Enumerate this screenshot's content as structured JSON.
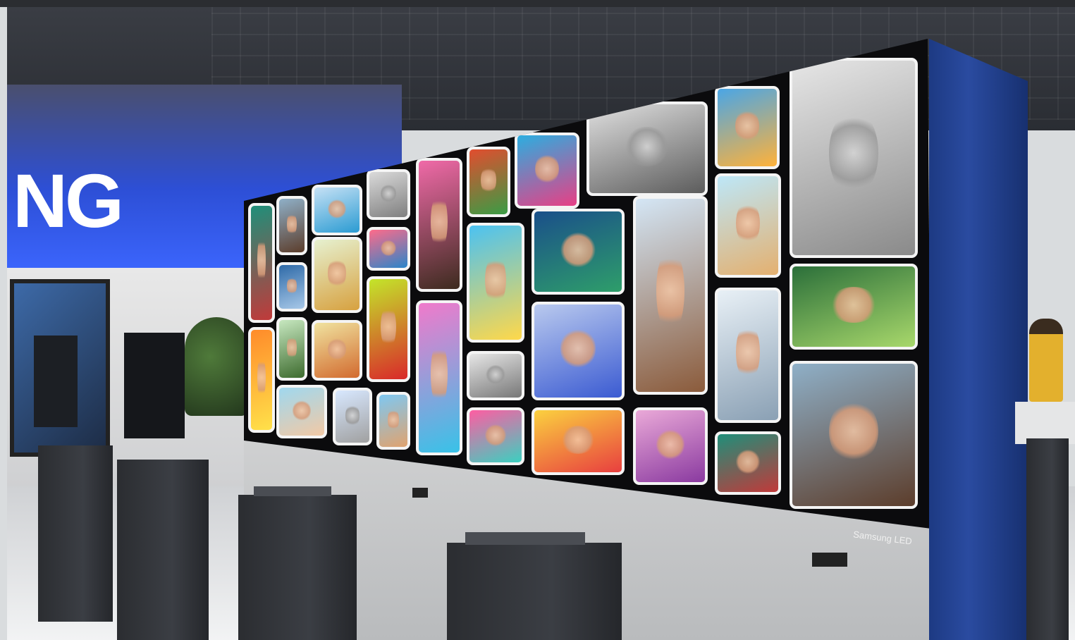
{
  "scene": {
    "brand_sign_text": "NG",
    "display_label": "Samsung LED"
  },
  "photos": [
    {
      "c1": "#1f8f7a",
      "c2": "#c13a3a"
    },
    {
      "c1": "#8fb0c8",
      "c2": "#5c3d2b"
    },
    {
      "c1": "#c6e1f5",
      "c2": "#2a9bd2"
    },
    {
      "c1": "#dadada",
      "c2": "#7f7f7f",
      "bw": true
    },
    {
      "c1": "#f06aa8",
      "c2": "#3d2b1f"
    },
    {
      "c1": "#e24d2f",
      "c2": "#3a9c45"
    },
    {
      "c1": "#2baee0",
      "c2": "#e83f85"
    },
    {
      "c1": "#e0e0e0",
      "c2": "#5c5c5c",
      "bw": true
    },
    {
      "c1": "#4aa6e6",
      "c2": "#ffb23a"
    },
    {
      "c1": "#e6e6e6",
      "c2": "#8a8a8a",
      "bw": true
    },
    {
      "c1": "#2e6aa8",
      "c2": "#a8c8e8"
    },
    {
      "c1": "#e6f1d0",
      "c2": "#d7a13f"
    },
    {
      "c1": "#ff6b8a",
      "c2": "#2b85c9"
    },
    {
      "c1": "#c3e52a",
      "c2": "#d9292a"
    },
    {
      "c1": "#4bc2f2",
      "c2": "#ffd84a"
    },
    {
      "c1": "#1a4f8a",
      "c2": "#2e9e6a"
    },
    {
      "c1": "#d4e6f5",
      "c2": "#8b5b3b"
    },
    {
      "c1": "#bde7f8",
      "c2": "#e4b06f"
    },
    {
      "c1": "#2b6f3a",
      "c2": "#a8d86b"
    },
    {
      "c1": "#ff8b2a",
      "c2": "#ffe14a"
    },
    {
      "c1": "#c7e8c0",
      "c2": "#3d6b2e"
    },
    {
      "c1": "#f0e3a0",
      "c2": "#d26a2e"
    },
    {
      "c1": "#f07acb",
      "c2": "#38c2e8"
    },
    {
      "c1": "#b9c9ee",
      "c2": "#3b5bd2"
    },
    {
      "c1": "#e8f0f6",
      "c2": "#8aa0b4"
    },
    {
      "c1": "#9fd8ef",
      "c2": "#f2c9a5"
    },
    {
      "c1": "#d8e8ff",
      "c2": "#a0a0a0",
      "bw": true
    },
    {
      "c1": "#7ec8f2",
      "c2": "#e0a36f"
    },
    {
      "c1": "#e6e6e6",
      "c2": "#777777",
      "bw": true
    },
    {
      "c1": "#ff5da2",
      "c2": "#3bd0c0"
    },
    {
      "c1": "#fbd13f",
      "c2": "#e83f3f"
    },
    {
      "c1": "#eaa9d8",
      "c2": "#8a3aa0"
    }
  ]
}
